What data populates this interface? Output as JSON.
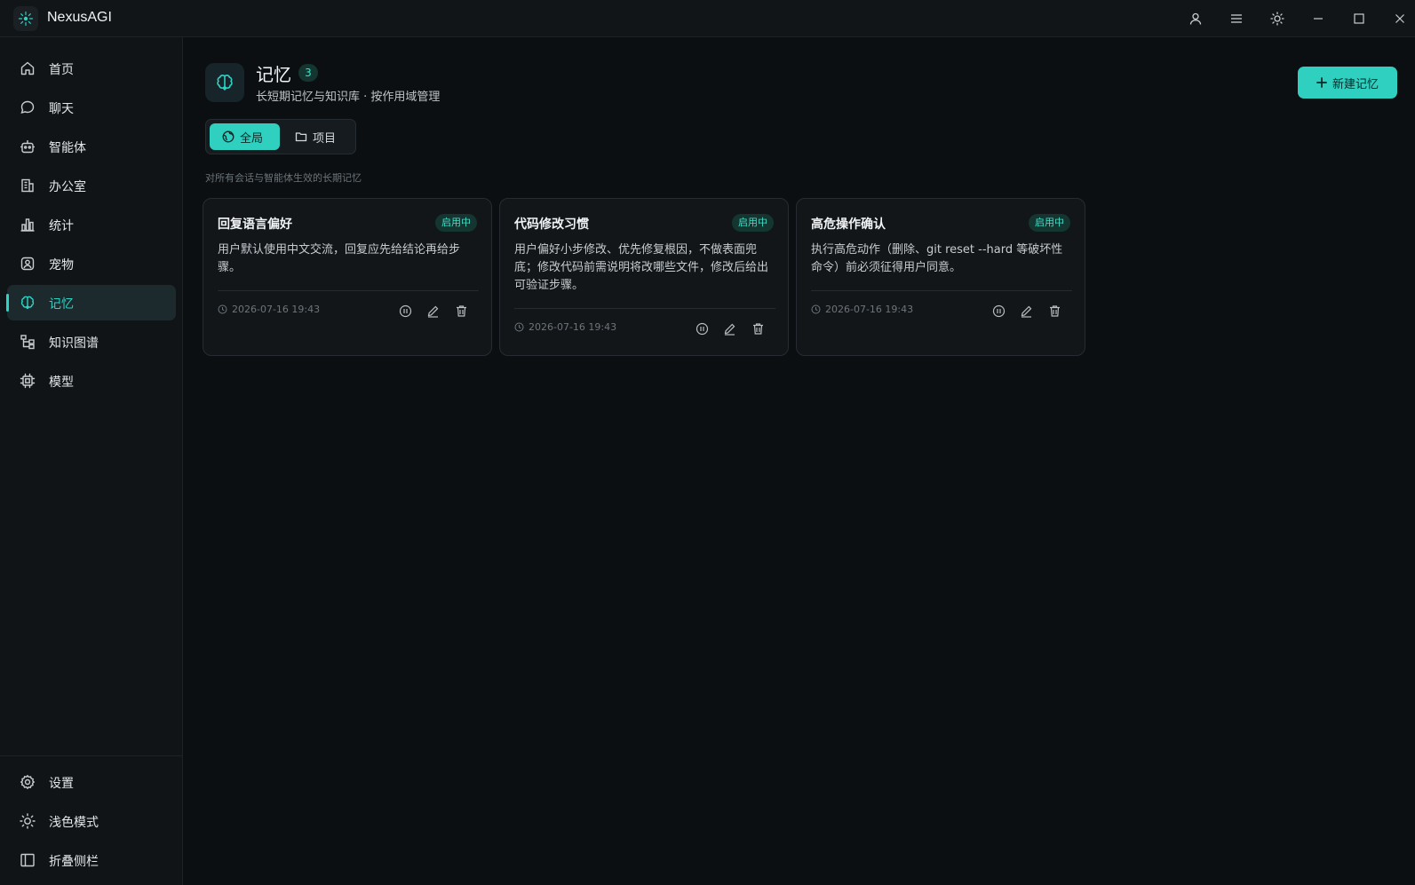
{
  "app": {
    "name": "NexusAGI"
  },
  "colors": {
    "accent": "#2fd0c0",
    "background": "#0c0f11",
    "sidebar": "#111417"
  },
  "titlebar_icons": [
    "user-icon",
    "menu-icon",
    "sun-icon",
    "minimize-icon",
    "maximize-icon",
    "close-icon"
  ],
  "sidebar": {
    "items": [
      {
        "label": "首页",
        "icon": "home-icon"
      },
      {
        "label": "聊天",
        "icon": "chat-icon"
      },
      {
        "label": "智能体",
        "icon": "robot-icon"
      },
      {
        "label": "办公室",
        "icon": "building-icon"
      },
      {
        "label": "统计",
        "icon": "bar-chart-icon"
      },
      {
        "label": "宠物",
        "icon": "pet-icon"
      },
      {
        "label": "记忆",
        "icon": "brain-icon",
        "active": true
      },
      {
        "label": "知识图谱",
        "icon": "tree-icon"
      },
      {
        "label": "模型",
        "icon": "chip-icon"
      }
    ],
    "bottom": [
      {
        "label": "设置",
        "icon": "gear-icon"
      },
      {
        "label": "浅色模式",
        "icon": "sun-icon"
      },
      {
        "label": "折叠侧栏",
        "icon": "sidebar-collapse-icon"
      }
    ]
  },
  "page": {
    "title": "记忆",
    "count": "3",
    "subtitle": "长短期记忆与知识库 · 按作用域管理",
    "new_button": "新建记忆"
  },
  "scope": {
    "tabs": [
      {
        "label": "全局",
        "icon": "globe-icon",
        "active": true
      },
      {
        "label": "项目",
        "icon": "folder-icon"
      }
    ],
    "description": "对所有会话与智能体生效的长期记忆"
  },
  "cards": [
    {
      "title": "回复语言偏好",
      "badge": "启用中",
      "body": "用户默认使用中文交流，回复应先给结论再给步骤。",
      "time": "2026-07-16 19:43"
    },
    {
      "title": "代码修改习惯",
      "badge": "启用中",
      "body": "用户偏好小步修改、优先修复根因，不做表面兜底；修改代码前需说明将改哪些文件，修改后给出可验证步骤。",
      "time": "2026-07-16 19:43"
    },
    {
      "title": "高危操作确认",
      "badge": "启用中",
      "body": "执行高危动作（删除、git reset --hard 等破坏性命令）前必须征得用户同意。",
      "time": "2026-07-16 19:43"
    }
  ]
}
